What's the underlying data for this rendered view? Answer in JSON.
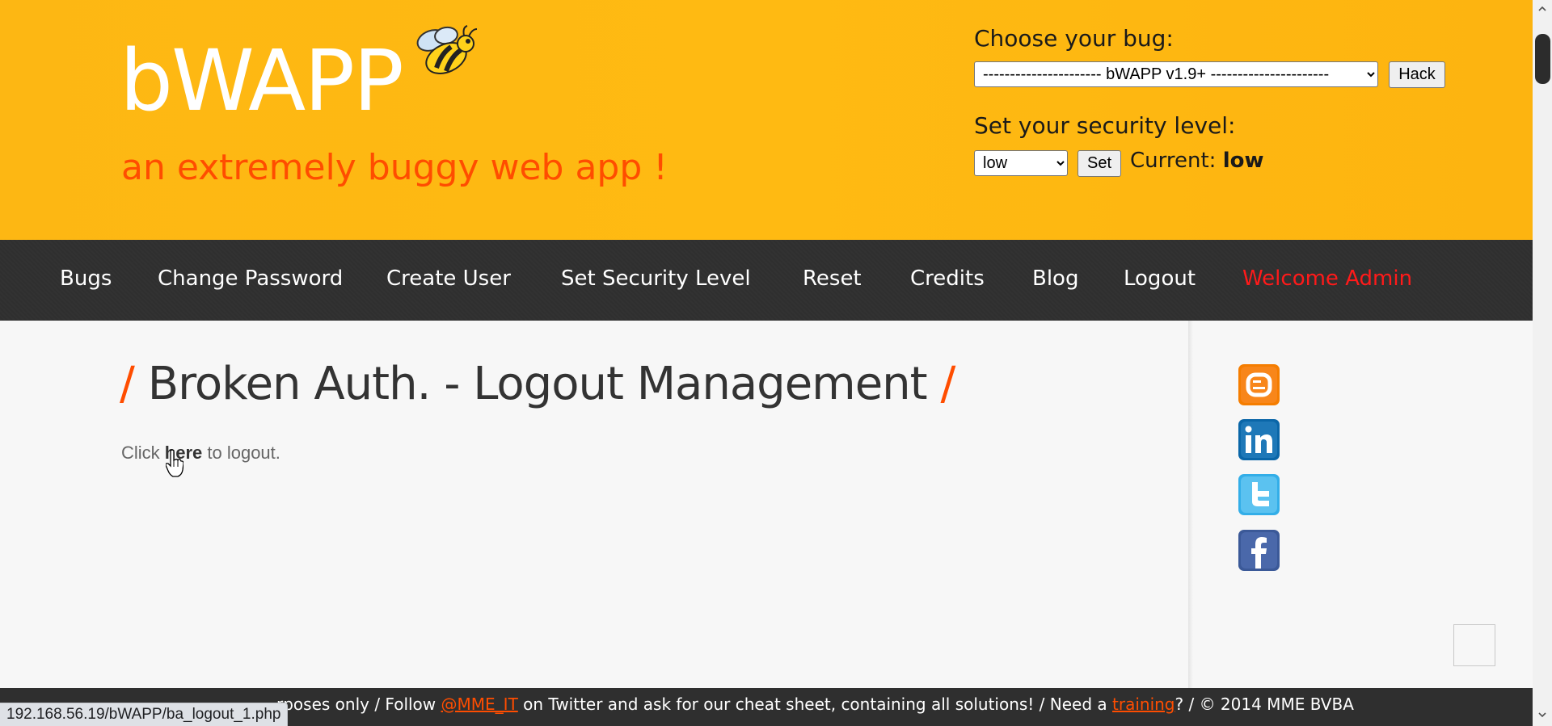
{
  "header": {
    "logo": "bWAPP",
    "tagline": "an extremely buggy web app !",
    "choose_bug_label": "Choose your bug:",
    "bug_select_value": "---------------------- bWAPP v1.9+ ----------------------",
    "hack_button": "Hack",
    "security_label": "Set your security level:",
    "security_select_value": "low",
    "set_button": "Set",
    "current_label": "Current:",
    "current_value": "low"
  },
  "menu": {
    "items": [
      "Bugs",
      "Change Password",
      "Create User",
      "Set Security Level",
      "Reset",
      "Credits",
      "Blog",
      "Logout",
      "Welcome Admin"
    ]
  },
  "main": {
    "title_slash_left": "/",
    "title": "Broken Auth. - Logout Management",
    "title_slash_right": "/",
    "text_before": "Click ",
    "link_text": "here",
    "text_after": " to logout."
  },
  "sidebar": {
    "icons": [
      "blogger-icon",
      "linkedin-icon",
      "twitter-icon",
      "facebook-icon"
    ]
  },
  "footer": {
    "text_part1": "rposes only / Follow ",
    "link1": "@MME_IT",
    "text_part2": " on Twitter and ask for our cheat sheet, containing all solutions! / Need a ",
    "link2": "training",
    "text_part3": "? / © 2014 MME BVBA"
  },
  "status_bar": {
    "url": "192.168.56.19/bWAPP/ba_logout_1.php"
  },
  "colors": {
    "header_bg": "#fdb713",
    "accent_orange": "#ff4d00",
    "menu_bg": "#2f2f2f",
    "welcome_red": "#ff1a1a"
  }
}
